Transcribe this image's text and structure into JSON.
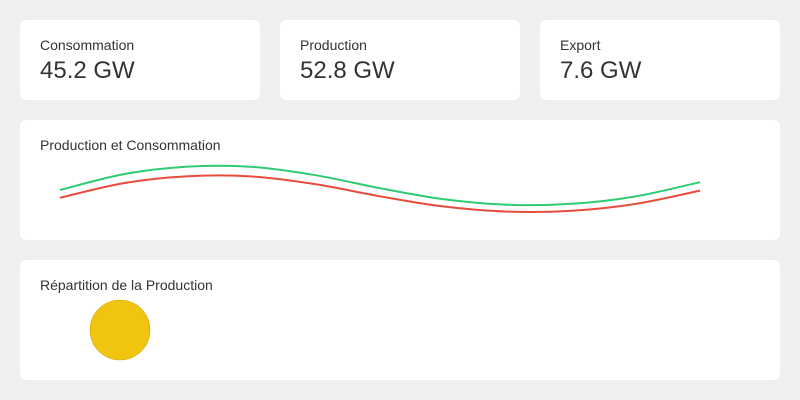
{
  "kpis": {
    "consumption": {
      "label": "Consommation",
      "value": "45.2 GW"
    },
    "production": {
      "label": "Production",
      "value": "52.8 GW"
    },
    "export": {
      "label": "Export",
      "value": "7.6 GW"
    }
  },
  "line_panel": {
    "title": "Production et Consommation"
  },
  "pie_panel": {
    "title": "Répartition de la Production"
  },
  "colors": {
    "background": "#efefef",
    "card": "#ffffff",
    "text": "#333333",
    "production_line": "#2ecc71",
    "consumption_line": "#e74c3c",
    "pie_slice": "#f1c40f",
    "pie_outline": "#d4a80a"
  },
  "chart_data": [
    {
      "type": "line",
      "title": "Production et Consommation",
      "x": [
        0,
        1,
        2,
        3,
        4,
        5,
        6,
        7,
        8,
        9,
        10
      ],
      "series": [
        {
          "values": [
            0.0,
            0.53,
            0.78,
            0.77,
            0.49,
            0.06,
            -0.31,
            -0.49,
            -0.46,
            -0.21,
            0.26
          ],
          "color": "#2ecc71"
        },
        {
          "values": [
            -0.26,
            0.23,
            0.46,
            0.45,
            0.19,
            -0.21,
            -0.55,
            -0.72,
            -0.69,
            -0.46,
            -0.02
          ],
          "color": "#e74c3c"
        }
      ],
      "ylim": [
        -1,
        1
      ],
      "grid": false,
      "legend": "none"
    },
    {
      "type": "pie",
      "title": "Répartition de la Production",
      "slices": [
        {
          "value": 100,
          "color": "#f1c40f"
        }
      ]
    }
  ]
}
